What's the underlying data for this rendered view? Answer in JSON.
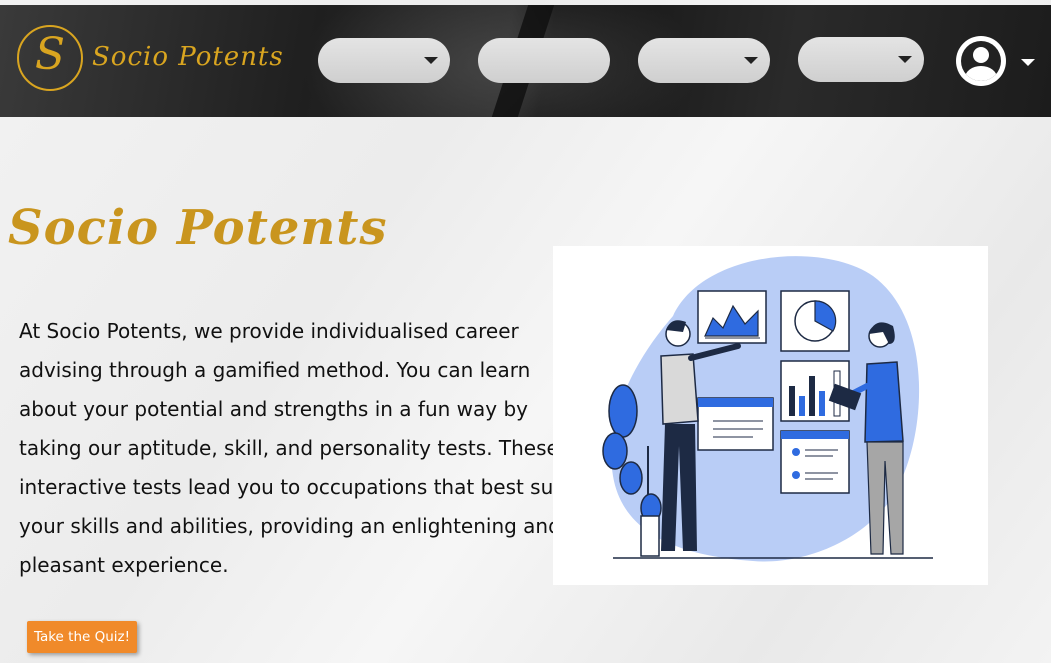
{
  "header": {
    "brand_small": "Socio Potents",
    "logo_letter": "S",
    "nav": [
      {
        "label": "",
        "has_caret": true
      },
      {
        "label": "",
        "has_caret": false
      },
      {
        "label": "",
        "has_caret": true
      },
      {
        "label": "",
        "has_caret": true
      }
    ],
    "account_icon": "user-circle-icon"
  },
  "hero": {
    "title": "Socio Potents",
    "description": "At Socio Potents, we provide individualised career advising through a gamified method. You can learn about your potential and strengths in a fun way by taking our aptitude, skill, and personality tests. These interactive tests lead you to occupations that best suit your skills and abilities, providing an enlightening and pleasant experience.",
    "cta_label": "Take the Quiz!"
  },
  "colors": {
    "brand_gold": "#c9951e",
    "cta_orange": "#f08a2a",
    "accent_blue": "#2f6be0",
    "blob_blue": "#b9cdf6"
  }
}
